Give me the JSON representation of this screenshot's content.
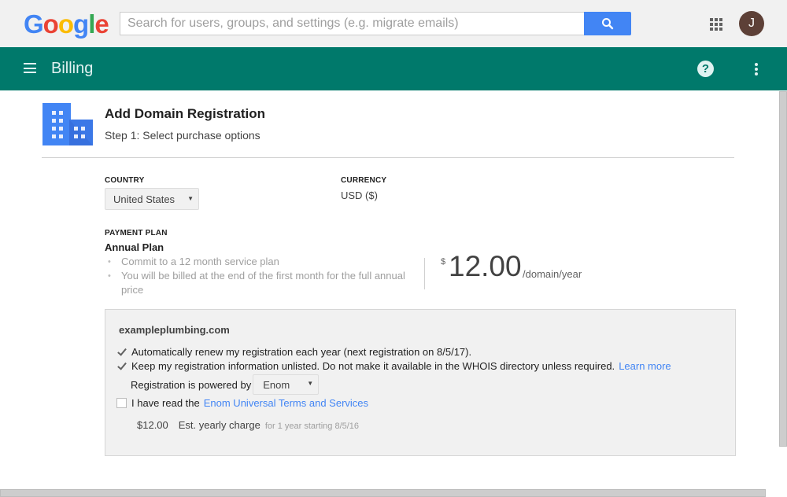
{
  "topbar": {
    "logo_letters": [
      {
        "ch": "G",
        "color": "#4285f4"
      },
      {
        "ch": "o",
        "color": "#ea4335"
      },
      {
        "ch": "o",
        "color": "#fbbc05"
      },
      {
        "ch": "g",
        "color": "#4285f4"
      },
      {
        "ch": "l",
        "color": "#34a853"
      },
      {
        "ch": "e",
        "color": "#ea4335"
      }
    ],
    "search_placeholder": "Search for users, groups, and settings (e.g. migrate emails)",
    "search_value": "",
    "avatar_initial": "J",
    "avatar_color": "#5d4037"
  },
  "appbar": {
    "title": "Billing",
    "color": "#00796b",
    "help_glyph": "?"
  },
  "page": {
    "title": "Add Domain Registration",
    "subtitle": "Step 1: Select purchase options"
  },
  "country": {
    "label": "COUNTRY",
    "selected": "United States"
  },
  "currency": {
    "label": "CURRENCY",
    "value": "USD ($)"
  },
  "payment_plan": {
    "label": "PAYMENT PLAN",
    "name": "Annual Plan",
    "bullets": [
      "Commit to a 12 month service plan",
      "You will be billed at the end of the first month for the full annual price"
    ],
    "price_currency": "$",
    "price_amount": "12.00",
    "price_unit": "/domain/year"
  },
  "domain": {
    "name": "exampleplumbing.com",
    "auto_renew": {
      "checked": true,
      "label": "Automatically renew my registration each year (next registration on 8/5/17)."
    },
    "unlisted": {
      "checked": true,
      "label": "Keep my registration information unlisted. Do not make it available in the WHOIS directory unless required.",
      "link": "Learn more"
    },
    "powered_by_label": "Registration is powered by",
    "registrar_selected": "Enom",
    "terms": {
      "checked": false,
      "label": "I have read the",
      "link": "Enom Universal Terms and Services"
    },
    "charge_amount": "$12.00",
    "charge_label": "Est. yearly charge",
    "charge_note": "for 1 year starting 8/5/16"
  },
  "link_color": "#4285f4"
}
